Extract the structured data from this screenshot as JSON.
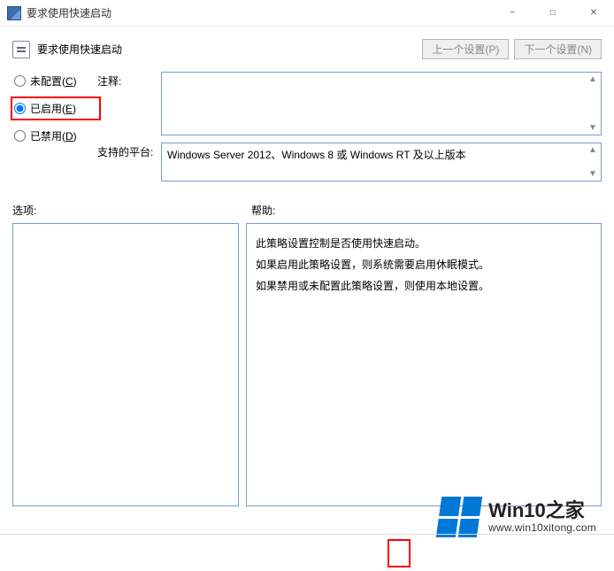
{
  "window": {
    "title": "要求使用快速启动"
  },
  "header": {
    "title": "要求使用快速启动",
    "prev_setting": "上一个设置(P)",
    "next_setting": "下一个设置(N)"
  },
  "radios": {
    "not_configured": {
      "label": "未配置(",
      "key": "C",
      "suffix": ")"
    },
    "enabled": {
      "label": "已启用(",
      "key": "E",
      "suffix": ")"
    },
    "disabled": {
      "label": "已禁用(",
      "key": "D",
      "suffix": ")"
    },
    "selected": "enabled"
  },
  "fields": {
    "comment_label": "注释:",
    "comment_value": "",
    "platform_label": "支持的平台:",
    "platform_value": "Windows Server 2012、Windows 8 或 Windows RT 及以上版本"
  },
  "labels": {
    "options": "选项:",
    "help": "帮助:"
  },
  "help": {
    "p1": "此策略设置控制是否使用快速启动。",
    "p2": "如果启用此策略设置，则系统需要启用休眠模式。",
    "p3": "如果禁用或未配置此策略设置，则使用本地设置。"
  },
  "watermark": {
    "brand": "Win10之家",
    "url": "www.win10xitong.com"
  }
}
